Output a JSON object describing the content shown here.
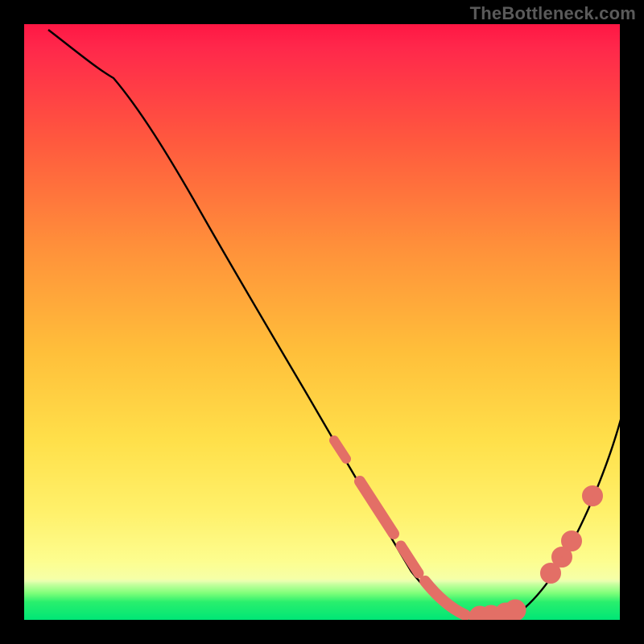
{
  "watermark": "TheBottleneck.com",
  "colors": {
    "black": "#000000",
    "curve": "#000000",
    "marker": "#e36f66",
    "gradient_top": "#ff1744",
    "gradient_mid_upper": "#ff7a2f",
    "gradient_mid": "#ffd23a",
    "gradient_mid_lower": "#fff16b",
    "gradient_green_band": "#29ef6d",
    "gradient_green_band_alt": "#00e676"
  },
  "chart_data": {
    "type": "line",
    "title": "",
    "xlabel": "",
    "ylabel": "",
    "xlim": [
      0,
      100
    ],
    "ylim": [
      0,
      100
    ],
    "note": "Axis values approximated by pixel position (no tick labels present)",
    "curve": [
      {
        "x": 4,
        "y": 99
      },
      {
        "x": 10,
        "y": 95
      },
      {
        "x": 15,
        "y": 91
      },
      {
        "x": 20,
        "y": 85
      },
      {
        "x": 26,
        "y": 76
      },
      {
        "x": 33,
        "y": 64
      },
      {
        "x": 40,
        "y": 52
      },
      {
        "x": 47,
        "y": 40
      },
      {
        "x": 54,
        "y": 27
      },
      {
        "x": 60,
        "y": 16
      },
      {
        "x": 65,
        "y": 8
      },
      {
        "x": 69,
        "y": 3
      },
      {
        "x": 72,
        "y": 1
      },
      {
        "x": 76,
        "y": 0.5
      },
      {
        "x": 80,
        "y": 1
      },
      {
        "x": 84,
        "y": 5
      },
      {
        "x": 88,
        "y": 12
      },
      {
        "x": 92,
        "y": 20
      },
      {
        "x": 96,
        "y": 29
      },
      {
        "x": 99,
        "y": 36
      }
    ],
    "marker_clusters": [
      {
        "x_start": 52,
        "x_end": 54,
        "style": "segment"
      },
      {
        "x_start": 56,
        "x_end": 62,
        "style": "segment"
      },
      {
        "x_start": 63,
        "x_end": 66,
        "style": "segment"
      },
      {
        "x_start": 67,
        "x_end": 74,
        "style": "segment"
      },
      {
        "x_start": 76,
        "x_end": 78,
        "style": "dots"
      },
      {
        "x_start": 80,
        "x_end": 82,
        "style": "dots"
      },
      {
        "x_start": 88,
        "x_end": 89,
        "style": "dot"
      },
      {
        "x_start": 90,
        "x_end": 92,
        "style": "dots"
      },
      {
        "x_start": 95,
        "x_end": 96,
        "style": "dot"
      }
    ]
  }
}
